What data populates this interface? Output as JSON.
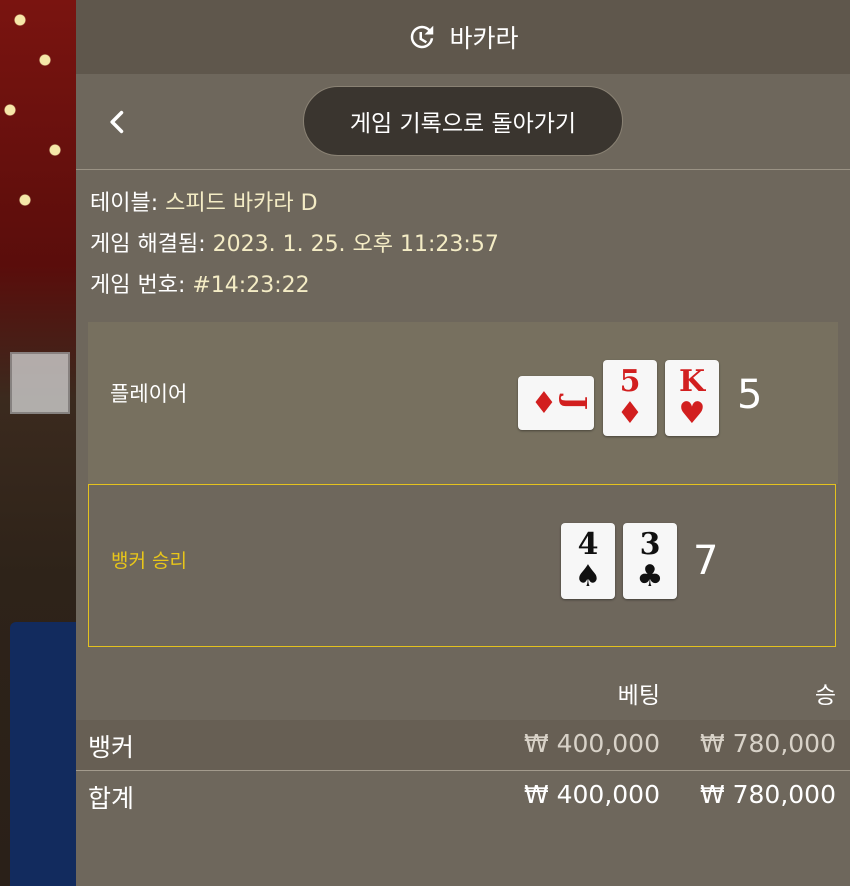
{
  "header": {
    "title": "바카라",
    "icon": "history-icon"
  },
  "nav": {
    "back_icon": "chevron-left-icon",
    "return_label": "게임 기록으로 돌아가기"
  },
  "info": {
    "table_label": "테이블:",
    "table_value": "스피드 바카라 D",
    "resolved_label": "게임 해결됨:",
    "resolved_value": "2023. 1. 25. 오후 11:23:57",
    "number_label": "게임 번호:",
    "number_value": "#14:23:22"
  },
  "player": {
    "label": "플레이어",
    "score": "5",
    "cards": [
      {
        "rank": "J",
        "suit": "♦",
        "color": "#d21f1f",
        "orientation": "sideways"
      },
      {
        "rank": "5",
        "suit": "♦",
        "color": "#d21f1f"
      },
      {
        "rank": "K",
        "suit": "♥",
        "color": "#d21f1f"
      }
    ]
  },
  "banker": {
    "label": "뱅커 승리",
    "score": "7",
    "highlight_color": "#e4c21e",
    "cards": [
      {
        "rank": "4",
        "suit": "♠",
        "color": "#111111"
      },
      {
        "rank": "3",
        "suit": "♣",
        "color": "#111111"
      }
    ]
  },
  "bets": {
    "headers": {
      "bet": "베팅",
      "win": "승"
    },
    "rows": [
      {
        "name": "뱅커",
        "bet": "₩ 400,000",
        "win": "₩ 780,000"
      },
      {
        "name": "합계",
        "bet": "₩ 400,000",
        "win": "₩ 780,000"
      }
    ]
  }
}
